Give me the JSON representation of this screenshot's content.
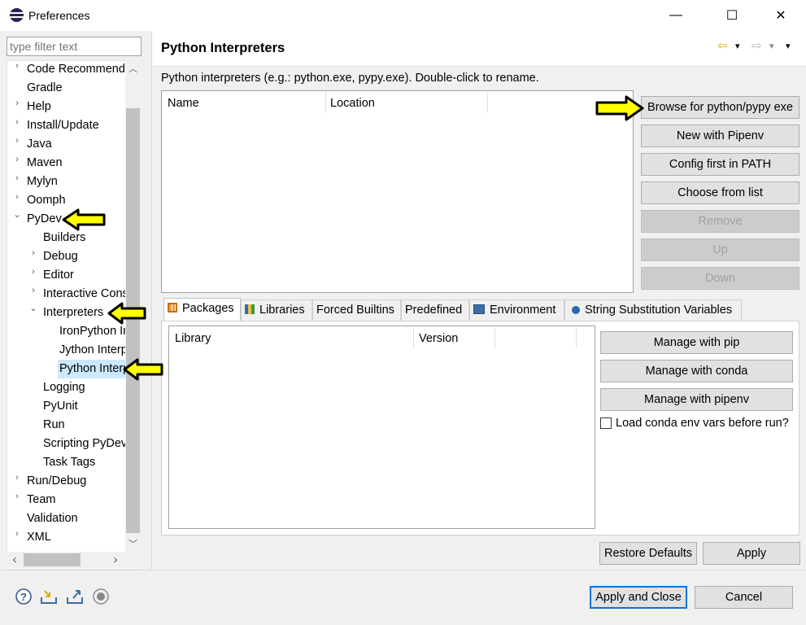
{
  "window": {
    "title": "Preferences",
    "minimize_glyph": "—",
    "maximize_glyph": "☐",
    "close_glyph": "✕"
  },
  "filter": {
    "placeholder": "type filter text"
  },
  "tree": {
    "items": [
      {
        "label": "Code Recommenders",
        "arrow": "›"
      },
      {
        "label": "Gradle",
        "arrow": ""
      },
      {
        "label": "Help",
        "arrow": "›"
      },
      {
        "label": "Install/Update",
        "arrow": "›"
      },
      {
        "label": "Java",
        "arrow": "›"
      },
      {
        "label": "Maven",
        "arrow": "›"
      },
      {
        "label": "Mylyn",
        "arrow": "›"
      },
      {
        "label": "Oomph",
        "arrow": "›"
      },
      {
        "label": "PyDev",
        "arrow": "⌄"
      },
      {
        "label": "Builders",
        "arrow": ""
      },
      {
        "label": "Debug",
        "arrow": "›"
      },
      {
        "label": "Editor",
        "arrow": "›"
      },
      {
        "label": "Interactive Console",
        "arrow": "›"
      },
      {
        "label": "Interpreters",
        "arrow": "⌄"
      },
      {
        "label": "IronPython Interpreter",
        "arrow": ""
      },
      {
        "label": "Jython Interpreter",
        "arrow": ""
      },
      {
        "label": "Python Interpreter",
        "arrow": ""
      },
      {
        "label": "Logging",
        "arrow": ""
      },
      {
        "label": "PyUnit",
        "arrow": ""
      },
      {
        "label": "Run",
        "arrow": ""
      },
      {
        "label": "Scripting PyDev",
        "arrow": ""
      },
      {
        "label": "Task Tags",
        "arrow": ""
      },
      {
        "label": "Run/Debug",
        "arrow": "›"
      },
      {
        "label": "Team",
        "arrow": "›"
      },
      {
        "label": "Validation",
        "arrow": ""
      },
      {
        "label": "XML",
        "arrow": "›"
      }
    ],
    "scroll_up": "︿",
    "scroll_down": "﹀",
    "scroll_left": "‹",
    "scroll_right": "›"
  },
  "page": {
    "title": "Python Interpreters",
    "description": "Python interpreters (e.g.: python.exe, pypy.exe).   Double-click to rename.",
    "nav_back": "⇦",
    "nav_forward": "⇨",
    "nav_menu": "▾"
  },
  "interpreters_table": {
    "columns": [
      "Name",
      "Location"
    ]
  },
  "interpreter_buttons": {
    "browse": "Browse for python/pypy exe",
    "new_pipenv": "New with Pipenv",
    "config_first": "Config first in PATH",
    "choose_list": "Choose from list",
    "remove": "Remove",
    "up": "Up",
    "down": "Down"
  },
  "tabs": [
    {
      "label": "Packages",
      "icon": "packages-icon",
      "active": true
    },
    {
      "label": "Libraries",
      "icon": "libraries-icon",
      "active": false
    },
    {
      "label": "Forced Builtins",
      "icon": "",
      "active": false
    },
    {
      "label": "Predefined",
      "icon": "",
      "active": false
    },
    {
      "label": "Environment",
      "icon": "environment-icon",
      "active": false
    },
    {
      "label": "String Substitution Variables",
      "icon": "variables-icon",
      "active": false
    }
  ],
  "library_table": {
    "columns": [
      "Library",
      "Version"
    ]
  },
  "package_buttons": {
    "pip": "Manage with pip",
    "conda": "Manage with conda",
    "pipenv": "Manage with pipenv",
    "conda_env_label": "Load conda env vars before run?",
    "conda_env_checked": false
  },
  "page_buttons": {
    "restore": "Restore Defaults",
    "apply": "Apply"
  },
  "dialog_buttons": {
    "apply_close": "Apply and Close",
    "cancel": "Cancel"
  },
  "colors": {
    "annotation_arrow": "#ffff00",
    "selection": "#cce8ff",
    "default_button_border": "#0078d7"
  }
}
